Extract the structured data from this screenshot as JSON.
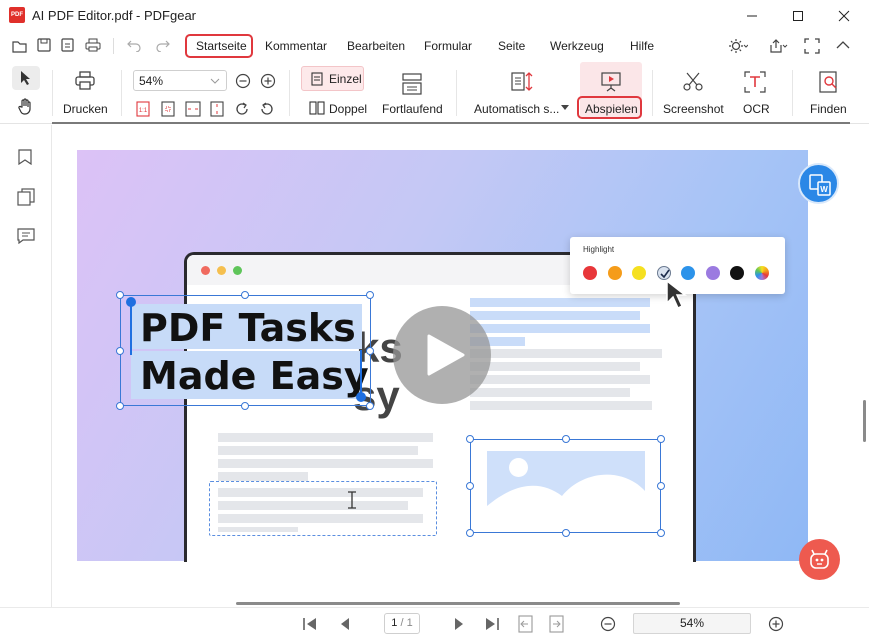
{
  "window": {
    "title": "AI PDF Editor.pdf - PDFgear",
    "app_icon_text": "PDF"
  },
  "menu": {
    "items": [
      "Startseite",
      "Kommentar",
      "Bearbeiten",
      "Formular",
      "Seite",
      "Werkzeug",
      "Hilfe"
    ],
    "active": "Startseite"
  },
  "toolbar": {
    "print_label": "Drucken",
    "zoom_value": "54%",
    "single_label": "Einzel",
    "double_label": "Doppel",
    "continuous_label": "Fortlaufend",
    "auto_label": "Automatisch s...",
    "play_label": "Abspielen",
    "screenshot_label": "Screenshot",
    "ocr_label": "OCR",
    "find_label": "Finden"
  },
  "page": {
    "headline_line1": "PDF Tasks",
    "headline_line2": "Made Easy",
    "ghost_text_1": "ks",
    "ghost_text_2": "sy",
    "highlight_popup_title": "Highlight",
    "highlight_colors": [
      "#e8373a",
      "#f59c1a",
      "#f5e020",
      "#d9e2ef",
      "#2c93ea",
      "#9b7ae0",
      "#111111",
      "#rainbow"
    ],
    "highlight_selected_index": 3
  },
  "bottom": {
    "page_indicator": "1 / 1",
    "page_current": "1",
    "page_total": "1",
    "zoom_value": "54%"
  }
}
